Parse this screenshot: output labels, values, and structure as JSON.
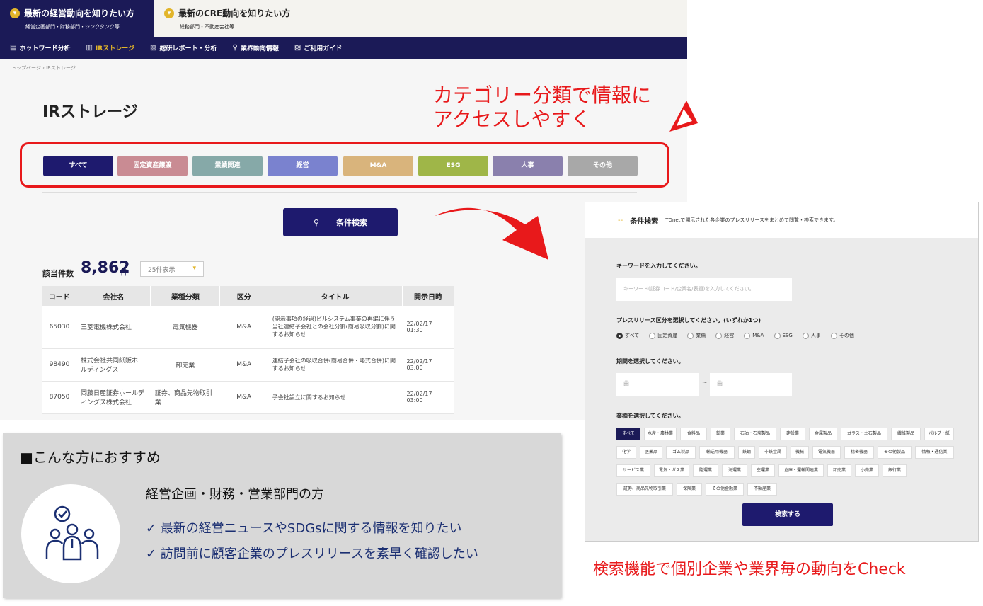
{
  "top_tabs": [
    {
      "title": "最新の経営動向を知りたい方",
      "sub": "経営企画部門・財務部門・シンクタンク等"
    },
    {
      "title": "最新のCRE動向を知りたい方",
      "sub": "総務部門・不動産会社等"
    }
  ],
  "nav": [
    {
      "icon": "hot-word-icon",
      "glyph": "▤",
      "label": "ホットワード分析"
    },
    {
      "icon": "building-icon",
      "glyph": "▥",
      "label": "IRストレージ"
    },
    {
      "icon": "report-icon",
      "glyph": "▧",
      "label": "総研レポート・分析"
    },
    {
      "icon": "search-icon",
      "glyph": "⚲",
      "label": "業界動向情報"
    },
    {
      "icon": "guide-icon",
      "glyph": "▨",
      "label": "ご利用ガイド"
    }
  ],
  "breadcrumb": "トップページ  ›  IRストレージ",
  "page_title": "IRストレージ",
  "callout_top": [
    "カテゴリー分類で情報に",
    "アクセスしやすく"
  ],
  "categories": [
    {
      "label": "すべて",
      "color": "#1e1a6e"
    },
    {
      "label": "固定資産譲渡",
      "color": "#c98b93"
    },
    {
      "label": "業績関連",
      "color": "#86a9a8"
    },
    {
      "label": "経営",
      "color": "#7a82cf"
    },
    {
      "label": "M&A",
      "color": "#d9b47c"
    },
    {
      "label": "ESG",
      "color": "#9fb648"
    },
    {
      "label": "人事",
      "color": "#8a80ad"
    },
    {
      "label": "その他",
      "color": "#a8a8a8"
    }
  ],
  "search_button": "条件検索",
  "count_label": "該当件数",
  "count_value": "8,862",
  "count_unit": "件",
  "per_page": "25件表示",
  "table": {
    "headers": [
      "コード",
      "会社名",
      "業種分類",
      "区分",
      "タイトル",
      "開示日時"
    ],
    "rows": [
      [
        "65030",
        "三菱電機株式会社",
        "電気機器",
        "M&A",
        "(開示事項の経過)ビルシステム事業の再編に伴う当社連結子会社との会社分割(簡易吸収分割)に関するお知らせ",
        "22/02/17 01:30"
      ],
      [
        "98490",
        "株式会社共同紙販ホールディングス",
        "卸売業",
        "M&A",
        "連結子会社の吸収合併(簡易合併・略式合併)に関するお知らせ",
        "22/02/17 03:00"
      ],
      [
        "87050",
        "岡藤日産証券ホールディングス株式会社",
        "証券、商品先物取引業",
        "M&A",
        "子会社設立に関するお知らせ",
        "22/02/17 03:00"
      ]
    ]
  },
  "panel": {
    "heading": "条件検索",
    "description": "TDnetで開示された各企業のプレスリリースをまとめて閲覧・検索できます。",
    "keyword_label": "キーワードを入力してください。",
    "keyword_placeholder": "キーワード(証券コード/企業名/表題)を入力してください。",
    "release_label": "プレスリリース区分を選択してください。(いずれか1つ)",
    "radios": [
      "すべて",
      "固定資産",
      "業績",
      "経営",
      "M&A",
      "ESG",
      "人事",
      "その他"
    ],
    "period_label": "期間を選択してください。",
    "date_from": "曲",
    "date_to": "曲",
    "tilde": "~",
    "industry_label": "業種を選択してください。",
    "industries": [
      [
        "すべて",
        "水産・農林業",
        "食料品",
        "鉱業",
        "石油・石炭製品",
        "建設業",
        "金属製品",
        "ガラス・土石製品",
        "繊維製品",
        "パルプ・紙"
      ],
      [
        "化学",
        "医薬品",
        "ゴム製品",
        "輸送用機器",
        "鉄鋼",
        "非鉄金属",
        "機械",
        "電気機器",
        "精密機器",
        "その他製品",
        "情報・通信業"
      ],
      [
        "サービス業",
        "電気・ガス業",
        "陸運業",
        "海運業",
        "空運業",
        "倉庫・運輸関連業",
        "卸売業",
        "小売業",
        "銀行業"
      ],
      [
        "証券、商品先物取引業",
        "保険業",
        "その他金融業",
        "不動産業"
      ]
    ],
    "submit": "検索する"
  },
  "callout_bottom": "検索機能で個別企業や業界毎の動向をCheck",
  "recommend": {
    "title": "■こんな方におすすめ",
    "subtitle": "経営企画・財務・営業部門の方",
    "items": [
      "✓ 最新の経営ニュースやSDGsに関する情報を知りたい",
      "✓ 訪問前に顧客企業のプレスリリースを素早く確認したい"
    ]
  }
}
